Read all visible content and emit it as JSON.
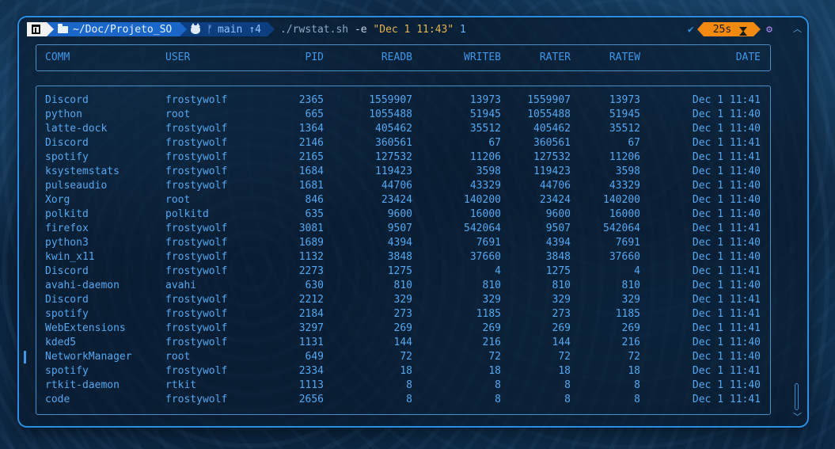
{
  "prompt": {
    "directory": "~/Doc/Projeto_SO",
    "git_branch": "main",
    "git_ahead": "↑4",
    "command_bin": "./rwstat.sh",
    "command_flag": "-e",
    "command_date": "\"Dec 1 11:43\"",
    "command_arg": "1",
    "check_glyph": "✔",
    "elapsed": "25s",
    "gear_glyph": "⚙",
    "branch_glyph": "ᚠ"
  },
  "colors": {
    "accent": "#2a8fe0",
    "text": "#55a7ef",
    "time_segment": "#f28a11",
    "dir_segment": "#1a66c9"
  },
  "table": {
    "headers": {
      "comm": "COMM",
      "user": "USER",
      "pid": "PID",
      "readb": "READB",
      "writeb": "WRITEB",
      "rater": "RATER",
      "ratew": "RATEW",
      "date": "DATE"
    },
    "rows": [
      {
        "comm": "Discord",
        "user": "frostywolf",
        "pid": "2365",
        "readb": "1559907",
        "writeb": "13973",
        "rater": "1559907",
        "ratew": "13973",
        "date": "Dec 1 11:41"
      },
      {
        "comm": "python",
        "user": "root",
        "pid": "665",
        "readb": "1055488",
        "writeb": "51945",
        "rater": "1055488",
        "ratew": "51945",
        "date": "Dec 1 11:40"
      },
      {
        "comm": "latte-dock",
        "user": "frostywolf",
        "pid": "1364",
        "readb": "405462",
        "writeb": "35512",
        "rater": "405462",
        "ratew": "35512",
        "date": "Dec 1 11:40"
      },
      {
        "comm": "Discord",
        "user": "frostywolf",
        "pid": "2146",
        "readb": "360561",
        "writeb": "67",
        "rater": "360561",
        "ratew": "67",
        "date": "Dec 1 11:41"
      },
      {
        "comm": "spotify",
        "user": "frostywolf",
        "pid": "2165",
        "readb": "127532",
        "writeb": "11206",
        "rater": "127532",
        "ratew": "11206",
        "date": "Dec 1 11:41"
      },
      {
        "comm": "ksystemstats",
        "user": "frostywolf",
        "pid": "1684",
        "readb": "119423",
        "writeb": "3598",
        "rater": "119423",
        "ratew": "3598",
        "date": "Dec 1 11:40"
      },
      {
        "comm": "pulseaudio",
        "user": "frostywolf",
        "pid": "1681",
        "readb": "44706",
        "writeb": "43329",
        "rater": "44706",
        "ratew": "43329",
        "date": "Dec 1 11:40"
      },
      {
        "comm": "Xorg",
        "user": "root",
        "pid": "846",
        "readb": "23424",
        "writeb": "140200",
        "rater": "23424",
        "ratew": "140200",
        "date": "Dec 1 11:40"
      },
      {
        "comm": "polkitd",
        "user": "polkitd",
        "pid": "635",
        "readb": "9600",
        "writeb": "16000",
        "rater": "9600",
        "ratew": "16000",
        "date": "Dec 1 11:40"
      },
      {
        "comm": "firefox",
        "user": "frostywolf",
        "pid": "3081",
        "readb": "9507",
        "writeb": "542064",
        "rater": "9507",
        "ratew": "542064",
        "date": "Dec 1 11:41"
      },
      {
        "comm": "python3",
        "user": "frostywolf",
        "pid": "1689",
        "readb": "4394",
        "writeb": "7691",
        "rater": "4394",
        "ratew": "7691",
        "date": "Dec 1 11:40"
      },
      {
        "comm": "kwin_x11",
        "user": "frostywolf",
        "pid": "1132",
        "readb": "3848",
        "writeb": "37660",
        "rater": "3848",
        "ratew": "37660",
        "date": "Dec 1 11:40"
      },
      {
        "comm": "Discord",
        "user": "frostywolf",
        "pid": "2273",
        "readb": "1275",
        "writeb": "4",
        "rater": "1275",
        "ratew": "4",
        "date": "Dec 1 11:41"
      },
      {
        "comm": "avahi-daemon",
        "user": "avahi",
        "pid": "630",
        "readb": "810",
        "writeb": "810",
        "rater": "810",
        "ratew": "810",
        "date": "Dec 1 11:40"
      },
      {
        "comm": "Discord",
        "user": "frostywolf",
        "pid": "2212",
        "readb": "329",
        "writeb": "329",
        "rater": "329",
        "ratew": "329",
        "date": "Dec 1 11:41"
      },
      {
        "comm": "spotify",
        "user": "frostywolf",
        "pid": "2184",
        "readb": "273",
        "writeb": "1185",
        "rater": "273",
        "ratew": "1185",
        "date": "Dec 1 11:41"
      },
      {
        "comm": "WebExtensions",
        "user": "frostywolf",
        "pid": "3297",
        "readb": "269",
        "writeb": "269",
        "rater": "269",
        "ratew": "269",
        "date": "Dec 1 11:41"
      },
      {
        "comm": "kded5",
        "user": "frostywolf",
        "pid": "1131",
        "readb": "144",
        "writeb": "216",
        "rater": "144",
        "ratew": "216",
        "date": "Dec 1 11:40"
      },
      {
        "comm": "NetworkManager",
        "user": "root",
        "pid": "649",
        "readb": "72",
        "writeb": "72",
        "rater": "72",
        "ratew": "72",
        "date": "Dec 1 11:40"
      },
      {
        "comm": "spotify",
        "user": "frostywolf",
        "pid": "2334",
        "readb": "18",
        "writeb": "18",
        "rater": "18",
        "ratew": "18",
        "date": "Dec 1 11:41"
      },
      {
        "comm": "rtkit-daemon",
        "user": "rtkit",
        "pid": "1113",
        "readb": "8",
        "writeb": "8",
        "rater": "8",
        "ratew": "8",
        "date": "Dec 1 11:40"
      },
      {
        "comm": "code",
        "user": "frostywolf",
        "pid": "2656",
        "readb": "8",
        "writeb": "8",
        "rater": "8",
        "ratew": "8",
        "date": "Dec 1 11:41"
      }
    ]
  },
  "scrollbar": {
    "up_glyph": "︿",
    "down_glyph": "﹀"
  }
}
